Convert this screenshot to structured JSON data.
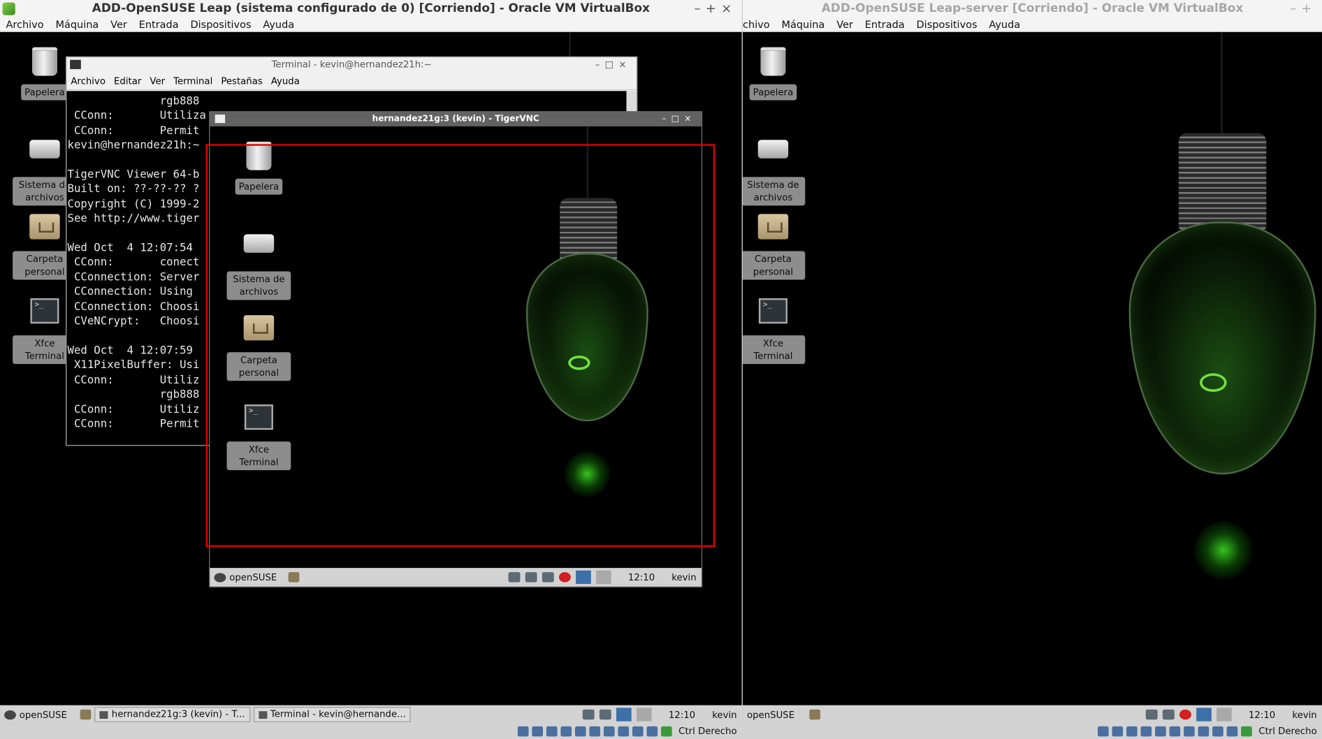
{
  "left_vm": {
    "window_title": "ADD-OpenSUSE Leap (sistema configurado de 0) [Corriendo] - Oracle VM VirtualBox",
    "menu": [
      "Archivo",
      "Máquina",
      "Ver",
      "Entrada",
      "Dispositivos",
      "Ayuda"
    ],
    "desktop_icons": [
      "Papelera",
      "Sistema de archivos",
      "Carpeta personal",
      "Xfce Terminal"
    ],
    "panel": {
      "start_label": "openSUSE",
      "tasks": [
        "hernandez21g:3 (kevin) - T...",
        "Terminal - kevin@hernande..."
      ],
      "clock": "12:10",
      "user": "kevin",
      "host_key": "Ctrl Derecho"
    }
  },
  "right_vm": {
    "window_title": "ADD-OpenSUSE Leap-server [Corriendo] - Oracle VM VirtualBox",
    "menu": [
      "chivo",
      "Máquina",
      "Ver",
      "Entrada",
      "Dispositivos",
      "Ayuda"
    ],
    "desktop_icons": [
      "Papelera",
      "Sistema de archivos",
      "Carpeta personal",
      "Xfce Terminal"
    ],
    "panel": {
      "start_label": "openSUSE",
      "clock": "12:10",
      "user": "kevin",
      "host_key": "Ctrl Derecho"
    }
  },
  "terminal": {
    "title": "Terminal - kevin@hernandez21h:~",
    "menu": [
      "Archivo",
      "Editar",
      "Ver",
      "Terminal",
      "Pestañas",
      "Ayuda"
    ],
    "lines": [
      "              rgb888",
      " CConn:       Utiliza",
      " CConn:       Permit",
      "kevin@hernandez21h:~",
      "",
      "TigerVNC Viewer 64-b",
      "Built on: ??-??-?? ?",
      "Copyright (C) 1999-2",
      "See http://www.tiger",
      "",
      "Wed Oct  4 12:07:54",
      " CConn:       conect",
      " CConnection: Server",
      " CConnection: Using",
      " CConnection: Choosi",
      " CVeNCrypt:   Choosi",
      "",
      "Wed Oct  4 12:07:59",
      " X11PixelBuffer: Usi",
      " CConn:       Utiliz",
      "              rgb888",
      " CConn:       Utiliz",
      " CConn:       Permit"
    ]
  },
  "vnc": {
    "title": "hernandez21g:3 (kevin) - TigerVNC",
    "desktop_icons": [
      "Papelera",
      "Sistema de archivos",
      "Carpeta personal",
      "Xfce Terminal"
    ],
    "panel": {
      "start_label": "openSUSE",
      "clock": "12:10",
      "user": "kevin"
    }
  },
  "colors": {
    "highlight_frame": "#e00000",
    "glow": "#36c21d"
  }
}
